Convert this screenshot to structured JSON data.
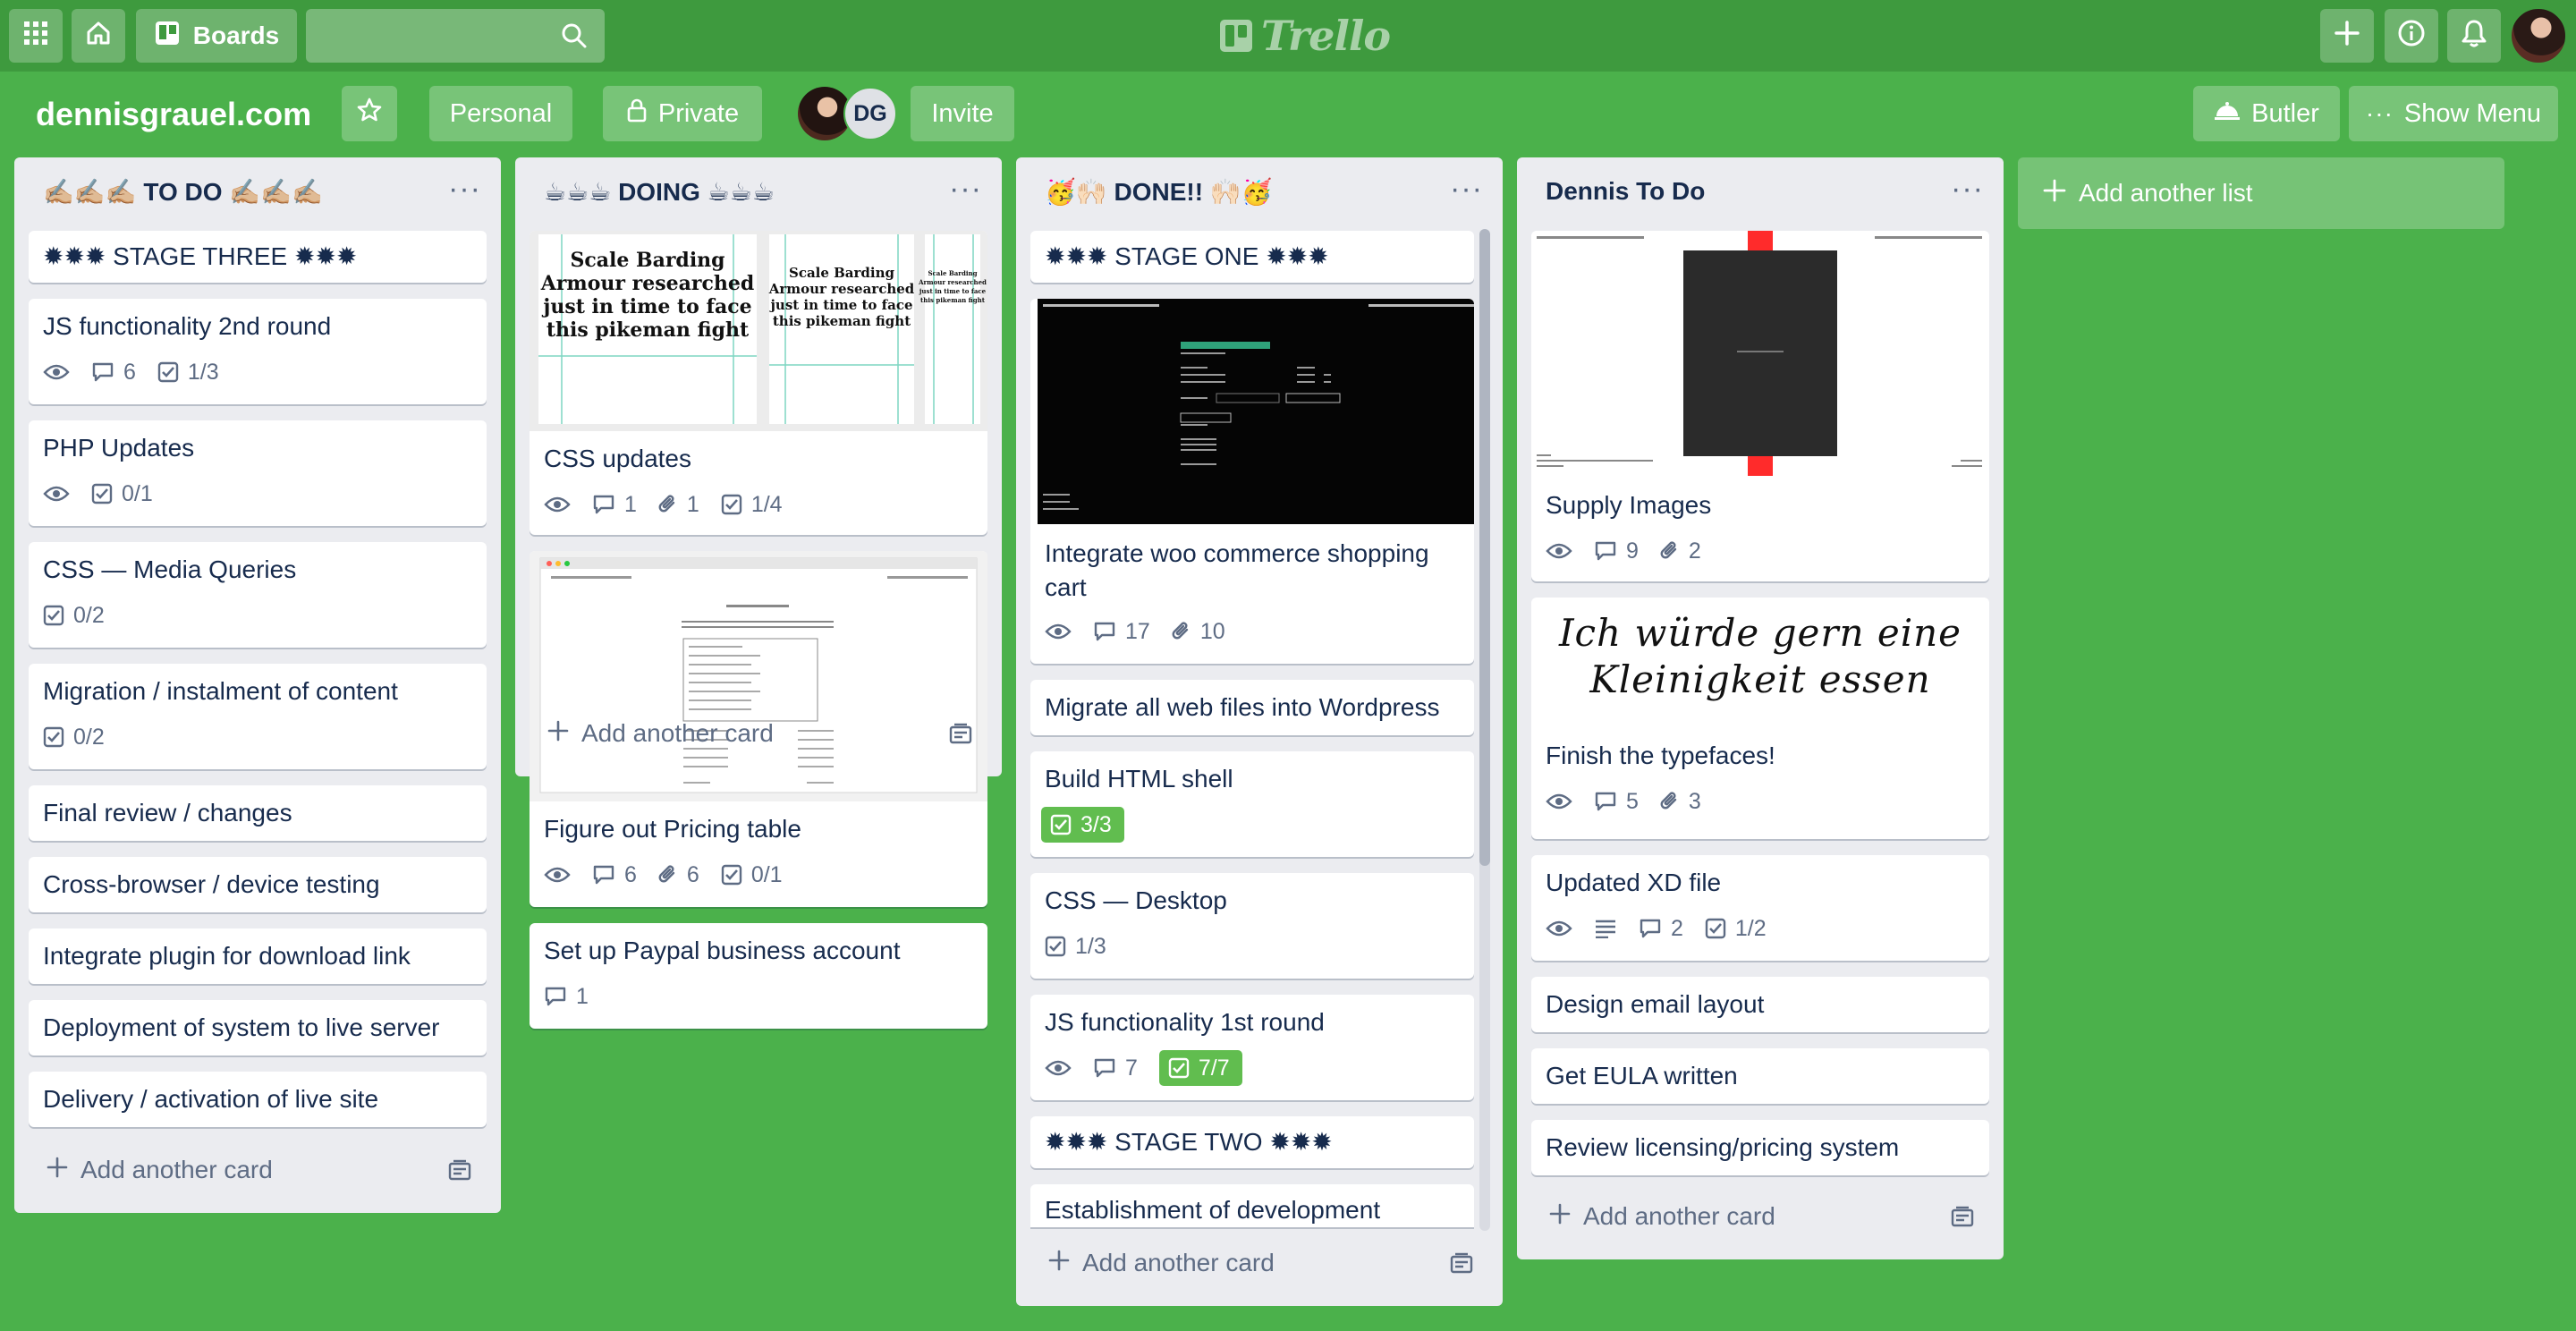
{
  "header": {
    "boards_label": "Boards",
    "logo_text": "Trello"
  },
  "board": {
    "title": "dennisgrauel.com",
    "visibility_team": "Personal",
    "visibility": "Private",
    "member_initials": "DG",
    "invite_label": "Invite",
    "butler_label": "Butler",
    "show_menu_label": "Show Menu",
    "background_color": "#4bb14b"
  },
  "lists": [
    {
      "title": "✍🏼✍🏼✍🏼 TO DO ✍🏼✍🏼✍🏼",
      "add_card_label": "Add another card",
      "cards": [
        {
          "title": "✹✹✹ STAGE THREE ✹✹✹"
        },
        {
          "title": "JS functionality 2nd round",
          "comments": "6",
          "checklist": "1/3"
        },
        {
          "title": "PHP Updates",
          "checklist": "0/1"
        },
        {
          "title": "CSS — Media Queries",
          "checklist": "0/2"
        },
        {
          "title": "Migration / instalment of content",
          "checklist": "0/2"
        },
        {
          "title": "Final review / changes"
        },
        {
          "title": "Cross-browser / device testing"
        },
        {
          "title": "Integrate plugin for download link"
        },
        {
          "title": "Deployment of system to live server"
        },
        {
          "title": "Delivery / activation of live site"
        }
      ]
    },
    {
      "title": "☕☕☕ DOING ☕☕☕",
      "add_card_label": "Add another card",
      "cards": [
        {
          "title": "CSS updates",
          "comments": "1",
          "attachments": "1",
          "checklist": "1/4",
          "cover_text": "Scale Barding Armour researched just in time to face this pikeman fight"
        },
        {
          "title": "Figure out Pricing table",
          "comments": "6",
          "attachments": "6",
          "checklist": "0/1"
        },
        {
          "title": "Set up Paypal business account",
          "comments": "1"
        }
      ]
    },
    {
      "title": "🥳🙌🏻 DONE!! 🙌🏻🥳",
      "add_card_label": "Add another card",
      "cards": [
        {
          "title": "✹✹✹ STAGE ONE ✹✹✹"
        },
        {
          "title": "Integrate woo commerce shopping cart",
          "comments": "17",
          "attachments": "10"
        },
        {
          "title": "Migrate all web files into Wordpress"
        },
        {
          "title": "Build HTML shell",
          "checklist": "3/3"
        },
        {
          "title": "CSS — Desktop",
          "checklist": "1/3"
        },
        {
          "title": "JS functionality 1st round",
          "comments": "7",
          "checklist": "7/7"
        },
        {
          "title": "✹✹✹ STAGE TWO ✹✹✹"
        },
        {
          "title": "Establishment of development"
        }
      ]
    },
    {
      "title": "Dennis To Do",
      "add_card_label": "Add another card",
      "cards": [
        {
          "title": "Supply Images",
          "comments": "9",
          "attachments": "2"
        },
        {
          "title": "Finish the typefaces!",
          "comments": "5",
          "attachments": "3",
          "cover_text": "Ich würde gern eine Kleinigkeit essen"
        },
        {
          "title": "Updated XD file",
          "comments": "2",
          "checklist": "1/2"
        },
        {
          "title": "Design email layout"
        },
        {
          "title": "Get EULA written"
        },
        {
          "title": "Review licensing/pricing system"
        }
      ]
    }
  ],
  "add_list_label": "Add another list",
  "colors": {
    "header_bg": "#3e9a3e",
    "list_bg": "#ebecf0",
    "badge_complete": "#61bd4f"
  }
}
